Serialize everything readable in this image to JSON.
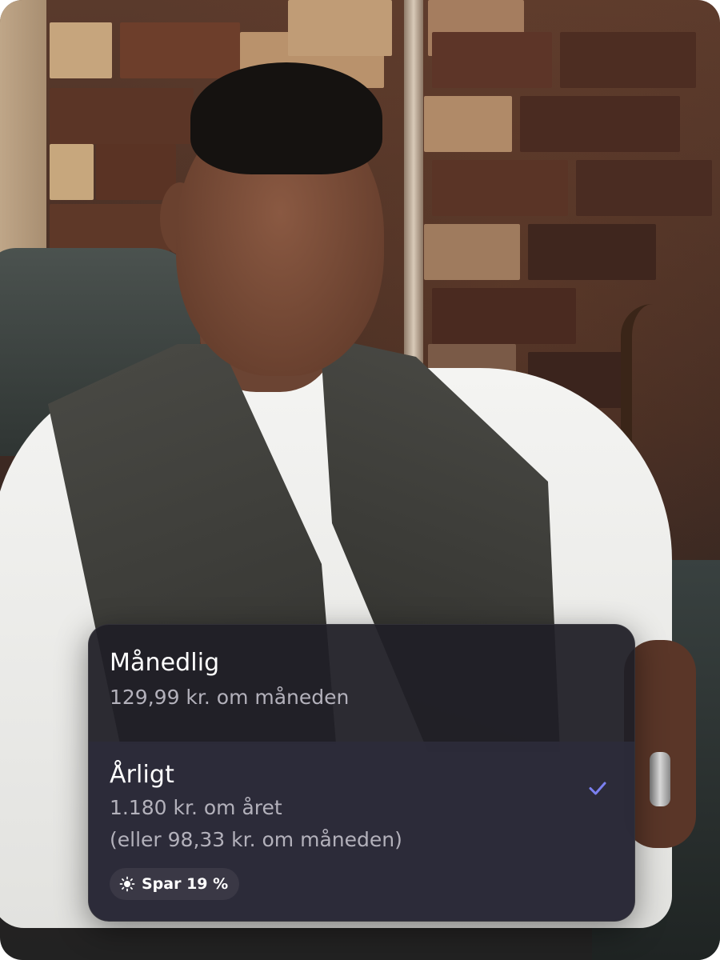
{
  "plans": [
    {
      "id": "monthly",
      "title": "Månedlig",
      "lines": [
        "129,99 kr. om måneden"
      ],
      "selected": false
    },
    {
      "id": "yearly",
      "title": "Årligt",
      "lines": [
        "1.180 kr. om året",
        "(eller 98,33 kr. om måneden)"
      ],
      "selected": true,
      "badge": {
        "icon": "sun-icon",
        "label": "Spar 19 %"
      }
    }
  ],
  "colors": {
    "card_bg": "#201f26",
    "selected_bg": "#2d2b3a",
    "accent": "#7b80f0",
    "subtle_text": "#b3b1bb"
  },
  "icons": {
    "selected_indicator": "checkmark-icon"
  }
}
